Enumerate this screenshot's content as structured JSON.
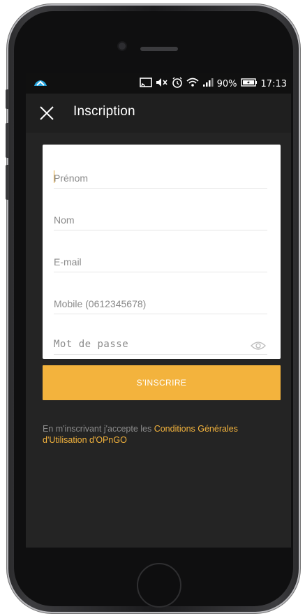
{
  "status": {
    "battery": "90%",
    "time": "17:13",
    "icons": [
      "app-cloud-icon",
      "cast-icon",
      "mute-icon",
      "alarm-icon",
      "wifi-icon",
      "signal-icon",
      "battery-charging-icon"
    ]
  },
  "appbar": {
    "close_icon": "close-icon",
    "title": "Inscription"
  },
  "form": {
    "firstname_placeholder": "Prénom",
    "lastname_placeholder": "Nom",
    "email_placeholder": "E-mail",
    "mobile_placeholder": "Mobile (0612345678)",
    "password_placeholder": "Mot de passe",
    "eye_icon": "eye-icon"
  },
  "submit_label": "S'INSCRIRE",
  "terms": {
    "prefix": "En m'inscrivant j'accepte les ",
    "link": "Conditions Générales d'Utilisation d'OPnGO"
  },
  "colors": {
    "accent": "#f3b33d",
    "background": "#242424",
    "appbar": "#1f1f1f",
    "statusbar": "#101010"
  }
}
